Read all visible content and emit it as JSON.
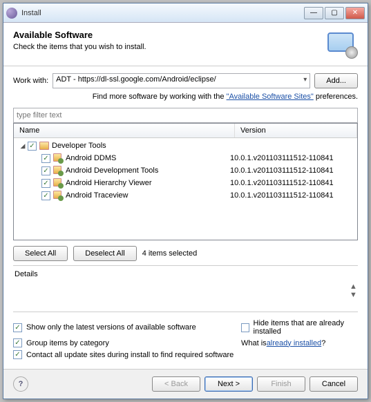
{
  "window": {
    "title": "Install"
  },
  "header": {
    "title": "Available Software",
    "subtitle": "Check the items that you wish to install."
  },
  "workwith": {
    "label": "Work with:",
    "value": "ADT - https://dl-ssl.google.com/Android/eclipse/",
    "add": "Add..."
  },
  "findmore": {
    "prefix": "Find more software by working with the ",
    "link": "\"Available Software Sites\"",
    "suffix": " preferences."
  },
  "filter": {
    "placeholder": "type filter text"
  },
  "tree": {
    "columns": {
      "name": "Name",
      "version": "Version"
    },
    "parent": {
      "label": "Developer Tools"
    },
    "items": [
      {
        "label": "Android DDMS",
        "version": "10.0.1.v201103111512-110841"
      },
      {
        "label": "Android Development Tools",
        "version": "10.0.1.v201103111512-110841"
      },
      {
        "label": "Android Hierarchy Viewer",
        "version": "10.0.1.v201103111512-110841"
      },
      {
        "label": "Android Traceview",
        "version": "10.0.1.v201103111512-110841"
      }
    ]
  },
  "selection": {
    "selectAll": "Select All",
    "deselectAll": "Deselect All",
    "count": "4 items selected"
  },
  "details": {
    "title": "Details"
  },
  "options": {
    "latest": "Show only the latest versions of available software",
    "hide": "Hide items that are already installed",
    "group": "Group items by category",
    "whatis": "What is ",
    "already_link": "already installed",
    "qmark": "?",
    "contact": "Contact all update sites during install to find required software"
  },
  "footer": {
    "back": "< Back",
    "next": "Next >",
    "finish": "Finish",
    "cancel": "Cancel"
  }
}
